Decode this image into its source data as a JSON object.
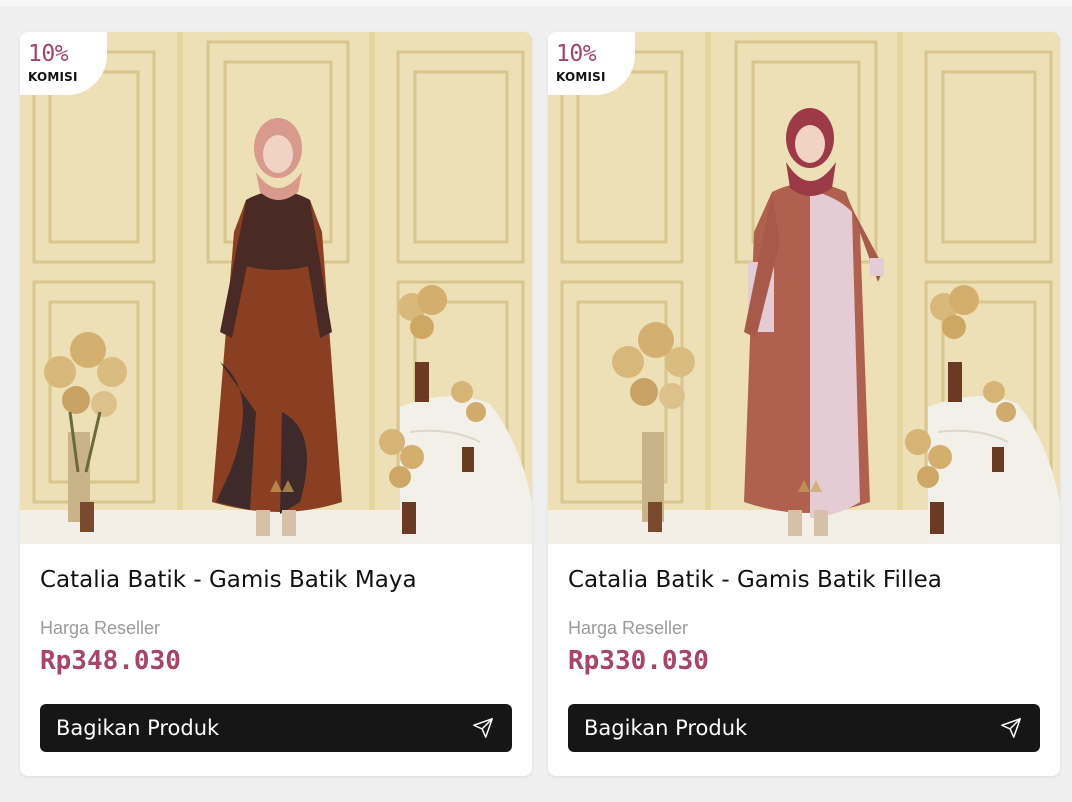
{
  "products": [
    {
      "commission_percent": "10%",
      "commission_label": "KOMISI",
      "name": "Catalia Batik - Gamis Batik Maya",
      "price_label": "Harga Reseller",
      "price": "Rp348.030",
      "share_label": "Bagikan Produk",
      "share_icon": "send-icon"
    },
    {
      "commission_percent": "10%",
      "commission_label": "KOMISI",
      "name": "Catalia Batik - Gamis Batik Fillea",
      "price_label": "Harga Reseller",
      "price": "Rp330.030",
      "share_label": "Bagikan Produk",
      "share_icon": "send-icon"
    }
  ],
  "colors": {
    "accent": "#a6446a",
    "button_bg": "#161616",
    "card_bg": "#ffffff",
    "page_bg": "#efefef"
  }
}
